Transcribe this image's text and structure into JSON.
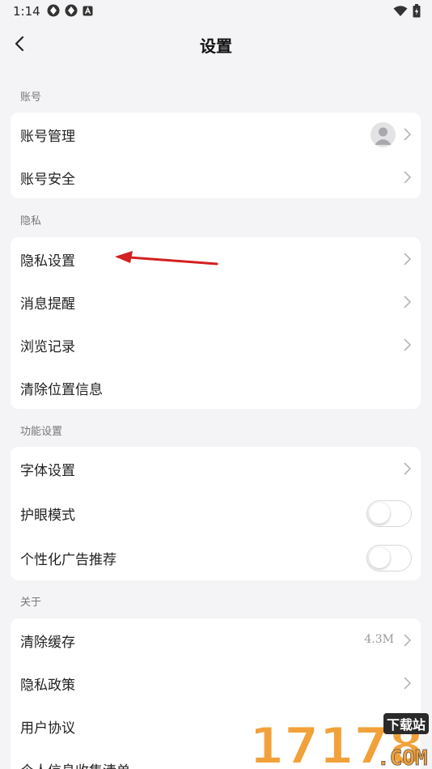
{
  "status_bar": {
    "time": "1:14",
    "left_icons": [
      "app-icon",
      "app-icon",
      "a-icon"
    ],
    "right_icons": [
      "wifi-icon",
      "battery-icon"
    ]
  },
  "header": {
    "title": "设置",
    "back_icon": "chevron-left-icon"
  },
  "sections": {
    "account": {
      "label": "账号",
      "items": [
        {
          "label": "账号管理"
        },
        {
          "label": "账号安全"
        }
      ]
    },
    "privacy": {
      "label": "隐私",
      "items": [
        {
          "label": "隐私设置"
        },
        {
          "label": "消息提醒"
        },
        {
          "label": "浏览记录"
        },
        {
          "label": "清除位置信息"
        }
      ]
    },
    "features": {
      "label": "功能设置",
      "items": [
        {
          "label": "字体设置"
        },
        {
          "label": "护眼模式",
          "toggle": false
        },
        {
          "label": "个性化广告推荐",
          "toggle": false
        }
      ]
    },
    "about": {
      "label": "关于",
      "items": [
        {
          "label": "清除缓存",
          "value": "4.3M"
        },
        {
          "label": "隐私政策"
        },
        {
          "label": "用户协议"
        },
        {
          "label": "个人信息收集清单"
        }
      ]
    }
  },
  "watermark": {
    "text": "17178",
    "badge": "下载站",
    "domain": ".COM"
  },
  "colors": {
    "background": "#f4f4f6",
    "card": "#ffffff",
    "annotation_arrow": "#d32020",
    "watermark_orange": "#f2a13a"
  }
}
